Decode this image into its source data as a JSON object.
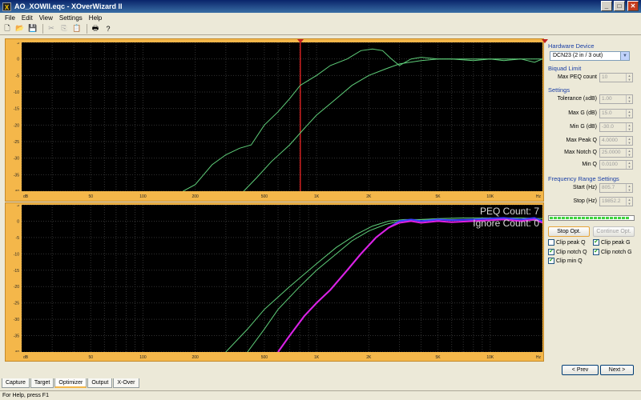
{
  "window": {
    "title": "AO_XOWII.eqc - XOverWizard II",
    "app_icon": "X",
    "min_glyph": "_",
    "max_glyph": "□",
    "close_glyph": "✕"
  },
  "menu": [
    "File",
    "Edit",
    "View",
    "Settings",
    "Help"
  ],
  "toolbar": {
    "icons": [
      {
        "name": "new-icon",
        "glyph": "🗋",
        "enabled": true
      },
      {
        "name": "open-icon",
        "glyph": "📂",
        "enabled": true
      },
      {
        "name": "save-icon",
        "glyph": "💾",
        "enabled": true
      },
      {
        "name": "cut-icon",
        "glyph": "✂",
        "enabled": false
      },
      {
        "name": "copy-icon",
        "glyph": "⎘",
        "enabled": false
      },
      {
        "name": "paste-icon",
        "glyph": "📋",
        "enabled": false
      },
      {
        "name": "print-icon",
        "glyph": "🖶",
        "enabled": true
      },
      {
        "name": "help-cursor-icon",
        "glyph": "?",
        "enabled": true
      }
    ]
  },
  "chart_data": [
    {
      "type": "line",
      "ylabel": "dB",
      "xlabel": "Hz",
      "ylim": [
        -40,
        5
      ],
      "y_ticks": [
        5,
        0,
        -5,
        -10,
        -15,
        -20,
        -25,
        -30,
        -35,
        -40
      ],
      "xlim": [
        20,
        20000
      ],
      "x_scale": "log",
      "x_ticks": [
        {
          "v": 50,
          "l": "50"
        },
        {
          "v": 100,
          "l": "100"
        },
        {
          "v": 200,
          "l": "200"
        },
        {
          "v": 500,
          "l": "500"
        },
        {
          "v": 1000,
          "l": "1K"
        },
        {
          "v": 2000,
          "l": "2K"
        },
        {
          "v": 5000,
          "l": "5K"
        },
        {
          "v": 10000,
          "l": "10K"
        }
      ],
      "x_start_label": "dB",
      "x_end_label": "Hz",
      "marker_freq": 805.7,
      "series": [
        {
          "color": "#5fcf7a",
          "x": [
            170,
            200,
            250,
            300,
            360,
            420,
            500,
            600,
            700,
            805,
            1000,
            1200,
            1500,
            1800,
            2100,
            2400,
            2700,
            3000,
            3500,
            4000,
            5000,
            6000,
            8000,
            10000,
            12000,
            15000,
            18000,
            20000
          ],
          "y": [
            -40,
            -38,
            -32,
            -29,
            -27,
            -26,
            -20,
            -16,
            -12,
            -8,
            -5,
            -2,
            0,
            2.5,
            3,
            2.5,
            0,
            -2,
            0,
            0.5,
            0,
            0,
            -0.5,
            0,
            -0.5,
            0,
            -1,
            0
          ]
        },
        {
          "color": "#5fcf7a",
          "x": [
            380,
            450,
            550,
            700,
            850,
            1000,
            1300,
            1600,
            2000,
            2500,
            3000,
            4000,
            5000,
            7000,
            10000,
            15000,
            20000
          ],
          "y": [
            -40,
            -36,
            -31,
            -26,
            -21,
            -17,
            -12,
            -8,
            -5,
            -3,
            -1.5,
            -0.5,
            0,
            0,
            0,
            0,
            0
          ]
        }
      ]
    },
    {
      "type": "line",
      "ylabel": "dB",
      "xlabel": "Hz",
      "ylim": [
        -40,
        5
      ],
      "y_ticks": [
        5,
        0,
        -5,
        -10,
        -15,
        -20,
        -25,
        -30,
        -35,
        -40
      ],
      "xlim": [
        20,
        20000
      ],
      "x_scale": "log",
      "x_ticks": [
        {
          "v": 50,
          "l": "50"
        },
        {
          "v": 100,
          "l": "100"
        },
        {
          "v": 200,
          "l": "200"
        },
        {
          "v": 500,
          "l": "500"
        },
        {
          "v": 1000,
          "l": "1K"
        },
        {
          "v": 2000,
          "l": "2K"
        },
        {
          "v": 5000,
          "l": "5K"
        },
        {
          "v": 10000,
          "l": "10K"
        }
      ],
      "x_start_label": "dB",
      "x_end_label": "Hz",
      "annotations": [
        "PEQ Count: 7",
        "Ignore Count: 0"
      ],
      "series": [
        {
          "color": "#5fcf7a",
          "x": [
            400,
            500,
            600,
            800,
            1000,
            1300,
            1600,
            2000,
            2500,
            3000,
            4000,
            5000,
            7000,
            10000,
            15000,
            20000
          ],
          "y": [
            -40,
            -33,
            -27,
            -20,
            -15,
            -10,
            -6,
            -3,
            -1,
            0,
            0.5,
            0.8,
            1,
            1,
            1,
            0.8
          ]
        },
        {
          "color": "#5fcf7a",
          "x": [
            300,
            400,
            500,
            700,
            1000,
            1300,
            1700,
            2100,
            2600,
            3200,
            4000,
            5000,
            7000,
            10000,
            15000,
            20000
          ],
          "y": [
            -40,
            -33,
            -27,
            -20,
            -13,
            -8,
            -4,
            -1.5,
            0,
            0.5,
            0.5,
            0.5,
            0.5,
            0.8,
            0.5,
            0
          ]
        },
        {
          "color": "#3b3bff",
          "x": [
            600,
            700,
            850,
            1000,
            1200,
            1500,
            1800,
            2200,
            2600,
            3000,
            3500,
            4000,
            5000,
            6000,
            8000,
            10000,
            12000,
            15000,
            18000,
            20000
          ],
          "y": [
            -40,
            -35,
            -29,
            -25,
            -21,
            -15,
            -10,
            -5,
            -2,
            0,
            0.5,
            0,
            0.5,
            0.3,
            0.5,
            0.8,
            1,
            0.5,
            1,
            0
          ]
        },
        {
          "color": "#e020e0",
          "x": [
            600,
            700,
            850,
            1000,
            1200,
            1500,
            1800,
            2200,
            2600,
            3000,
            3500,
            4000,
            5000,
            6000,
            8000,
            10000,
            12000,
            15000,
            18000,
            20000
          ],
          "y": [
            -40,
            -35,
            -29,
            -25,
            -21,
            -15,
            -10,
            -5,
            -2,
            -0.5,
            0,
            -0.5,
            0,
            -0.3,
            0,
            0.3,
            0.5,
            0,
            0.5,
            -0.5
          ]
        }
      ]
    }
  ],
  "side": {
    "hardware_title": "Hardware Device",
    "hardware_value": "DCN23 (2 in / 3 out)",
    "biquad_title": "Biquad Limit",
    "max_peq_label": "Max PEQ count",
    "max_peq_value": "10",
    "settings_title": "Settings",
    "tolerance_label": "Tolerance (±dB)",
    "tolerance_value": "1.00",
    "max_g_label": "Max G (dB)",
    "max_g_value": "15.0",
    "min_g_label": "Min G (dB)",
    "min_g_value": "-30.0",
    "max_peak_q_label": "Max Peak Q",
    "max_peak_q_value": "4.0000",
    "max_notch_q_label": "Max Notch Q",
    "max_notch_q_value": "25.0000",
    "min_q_label": "Min Q",
    "min_q_value": "0.0100",
    "freq_title": "Frequency Range Settings",
    "start_label": "Start (Hz)",
    "start_value": "805.7",
    "stop_label": "Stop (Hz)",
    "stop_value": "19852.2",
    "progress_fraction": 1.0,
    "stop_opt_label": "Stop Opt.",
    "continue_opt_label": "Continue Opt.",
    "checkboxes": [
      {
        "label": "Clip peak Q",
        "checked": false
      },
      {
        "label": "Clip peak G",
        "checked": true
      },
      {
        "label": "Clip notch Q",
        "checked": true
      },
      {
        "label": "Clip notch G",
        "checked": true
      },
      {
        "label": "Clip min Q",
        "checked": true
      }
    ],
    "prev_label": "< Prev",
    "next_label": "Next >"
  },
  "tabs": [
    {
      "label": "Capture",
      "active": false
    },
    {
      "label": "Target",
      "active": false
    },
    {
      "label": "Optimizer",
      "active": true
    },
    {
      "label": "Output",
      "active": false
    },
    {
      "label": "X-Over",
      "active": false
    }
  ],
  "status": "For Help, press F1"
}
